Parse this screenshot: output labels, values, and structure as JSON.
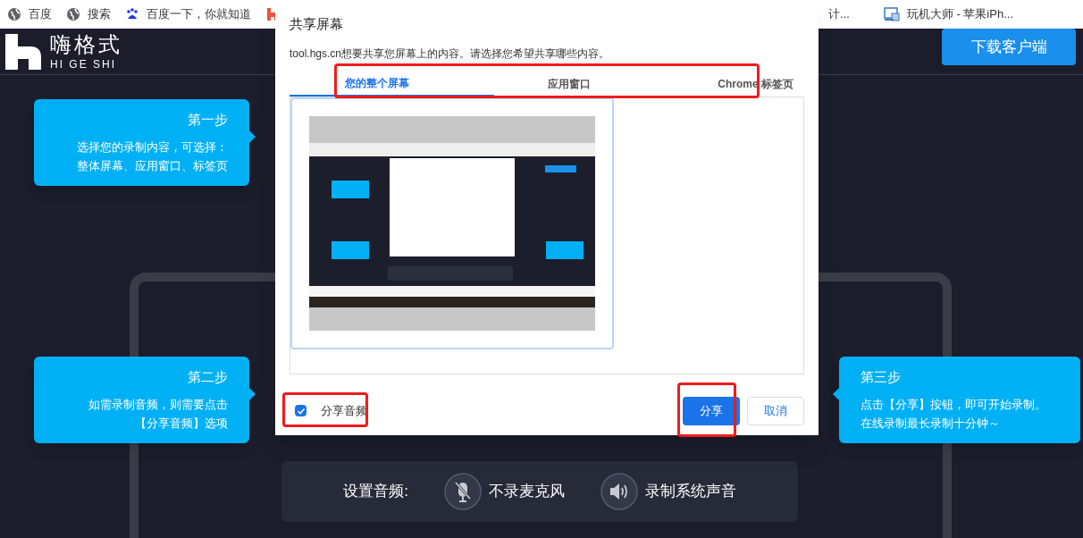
{
  "bookmarks": [
    {
      "label": "百度",
      "kind": "globe"
    },
    {
      "label": "搜索",
      "kind": "globe"
    },
    {
      "label": "百度一下，你就知道",
      "kind": "paw"
    },
    {
      "kind": "logo"
    }
  ],
  "bookmarks_right": [
    {
      "label": "计...",
      "kind": "none"
    },
    {
      "label": "玩机大师 - 苹果iPh...",
      "kind": "monitor"
    }
  ],
  "header": {
    "logo_cn": "嗨格式",
    "logo_en": "HI GE SHI",
    "download_button": "下载客户端"
  },
  "steps": [
    {
      "title": "第一步",
      "lines": [
        "选择您的录制内容，可选择：",
        "整体屏幕、应用窗口、标签页"
      ],
      "kind": "pointer-right"
    },
    {
      "title": "第二步",
      "lines": [
        "如需录制音频，则需要点击",
        "【分享音频】选项"
      ],
      "kind": "pointer-right"
    },
    {
      "title": "第三步",
      "lines": [
        "点击【分享】按钮，即可开始录制。",
        "在线录制最长录制十分钟～"
      ],
      "kind": "pointer-left"
    }
  ],
  "dialog": {
    "title": "共享屏幕",
    "subtitle": "tool.hgs.cn想要共享您屏幕上的内容。请选择您希望共享哪些内容。",
    "tabs": [
      {
        "label": "您的整个屏幕",
        "selected": true
      },
      {
        "label": "应用窗口",
        "selected": false
      },
      {
        "label": "Chrome 标签页",
        "selected": false
      }
    ],
    "share_audio": {
      "label": "分享音频",
      "checked": true
    },
    "buttons": [
      {
        "label": "分享",
        "kind": "primary"
      },
      {
        "label": "取消",
        "kind": "secondary"
      }
    ]
  },
  "audio_settings": {
    "label": "设置音频:",
    "options": [
      {
        "label": "不录麦克风",
        "kind": "mic-off"
      },
      {
        "label": "录制系统声音",
        "kind": "speaker"
      }
    ]
  }
}
